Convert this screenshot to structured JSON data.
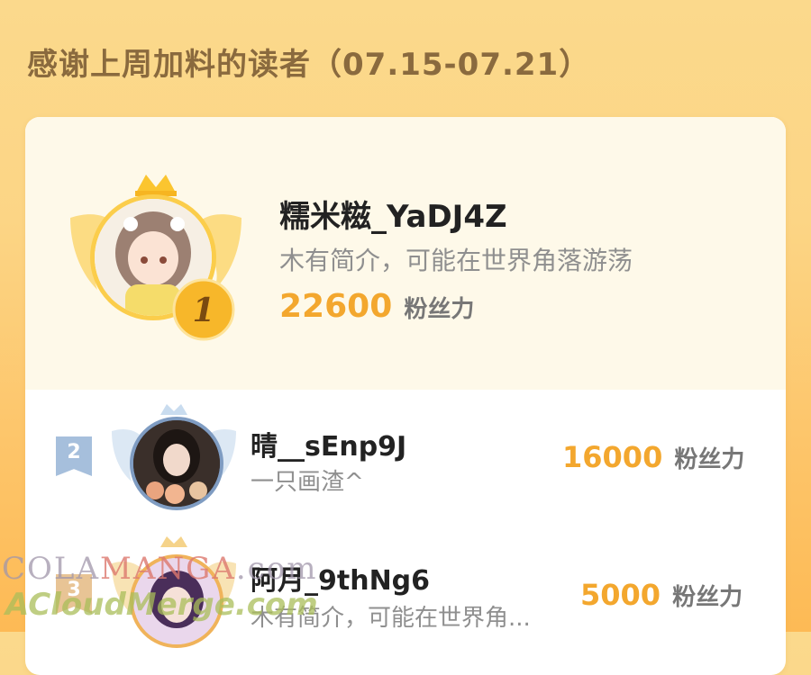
{
  "header": {
    "title": "感谢上周加料的读者（07.15-07.21）"
  },
  "readers": [
    {
      "rank": "1",
      "nickname": "糯米糍_YaDJ4Z",
      "bio": "木有简介，可能在世界角落游荡",
      "fans": "22600",
      "fans_unit": "粉丝力"
    },
    {
      "rank": "2",
      "nickname": "晴__sEnp9J",
      "bio": "一只画渣^",
      "fans": "16000",
      "fans_unit": "粉丝力"
    },
    {
      "rank": "3",
      "nickname": "阿月_9thNg6",
      "bio": "木有简介，可能在世界角...",
      "fans": "5000",
      "fans_unit": "粉丝力"
    }
  ],
  "watermark": {
    "line1_a": "COLA",
    "line1_b": "MANGA",
    "line1_c": ".com",
    "line2": "ACloudMerge.com"
  },
  "colors": {
    "accent": "#f3a72e",
    "background": "#fcd585",
    "rank1": "#f6b521",
    "rank2": "#a6bfdc"
  }
}
